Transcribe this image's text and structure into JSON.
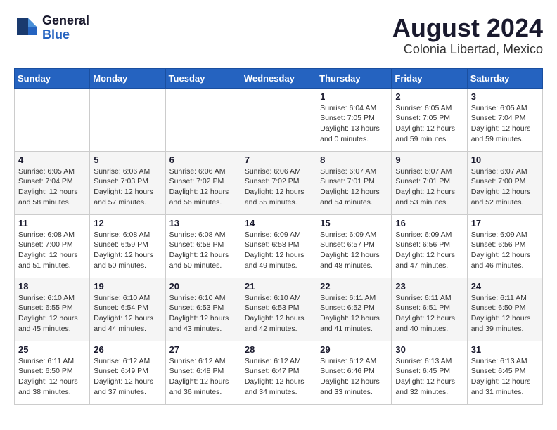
{
  "header": {
    "logo_general": "General",
    "logo_blue": "Blue",
    "title": "August 2024",
    "subtitle": "Colonia Libertad, Mexico"
  },
  "weekdays": [
    "Sunday",
    "Monday",
    "Tuesday",
    "Wednesday",
    "Thursday",
    "Friday",
    "Saturday"
  ],
  "weeks": [
    [
      null,
      null,
      null,
      null,
      {
        "day": "1",
        "sunrise": "6:04 AM",
        "sunset": "7:05 PM",
        "daylight": "13 hours and 0 minutes."
      },
      {
        "day": "2",
        "sunrise": "6:05 AM",
        "sunset": "7:05 PM",
        "daylight": "12 hours and 59 minutes."
      },
      {
        "day": "3",
        "sunrise": "6:05 AM",
        "sunset": "7:04 PM",
        "daylight": "12 hours and 59 minutes."
      }
    ],
    [
      {
        "day": "4",
        "sunrise": "6:05 AM",
        "sunset": "7:04 PM",
        "daylight": "12 hours and 58 minutes."
      },
      {
        "day": "5",
        "sunrise": "6:06 AM",
        "sunset": "7:03 PM",
        "daylight": "12 hours and 57 minutes."
      },
      {
        "day": "6",
        "sunrise": "6:06 AM",
        "sunset": "7:02 PM",
        "daylight": "12 hours and 56 minutes."
      },
      {
        "day": "7",
        "sunrise": "6:06 AM",
        "sunset": "7:02 PM",
        "daylight": "12 hours and 55 minutes."
      },
      {
        "day": "8",
        "sunrise": "6:07 AM",
        "sunset": "7:01 PM",
        "daylight": "12 hours and 54 minutes."
      },
      {
        "day": "9",
        "sunrise": "6:07 AM",
        "sunset": "7:01 PM",
        "daylight": "12 hours and 53 minutes."
      },
      {
        "day": "10",
        "sunrise": "6:07 AM",
        "sunset": "7:00 PM",
        "daylight": "12 hours and 52 minutes."
      }
    ],
    [
      {
        "day": "11",
        "sunrise": "6:08 AM",
        "sunset": "7:00 PM",
        "daylight": "12 hours and 51 minutes."
      },
      {
        "day": "12",
        "sunrise": "6:08 AM",
        "sunset": "6:59 PM",
        "daylight": "12 hours and 50 minutes."
      },
      {
        "day": "13",
        "sunrise": "6:08 AM",
        "sunset": "6:58 PM",
        "daylight": "12 hours and 50 minutes."
      },
      {
        "day": "14",
        "sunrise": "6:09 AM",
        "sunset": "6:58 PM",
        "daylight": "12 hours and 49 minutes."
      },
      {
        "day": "15",
        "sunrise": "6:09 AM",
        "sunset": "6:57 PM",
        "daylight": "12 hours and 48 minutes."
      },
      {
        "day": "16",
        "sunrise": "6:09 AM",
        "sunset": "6:56 PM",
        "daylight": "12 hours and 47 minutes."
      },
      {
        "day": "17",
        "sunrise": "6:09 AM",
        "sunset": "6:56 PM",
        "daylight": "12 hours and 46 minutes."
      }
    ],
    [
      {
        "day": "18",
        "sunrise": "6:10 AM",
        "sunset": "6:55 PM",
        "daylight": "12 hours and 45 minutes."
      },
      {
        "day": "19",
        "sunrise": "6:10 AM",
        "sunset": "6:54 PM",
        "daylight": "12 hours and 44 minutes."
      },
      {
        "day": "20",
        "sunrise": "6:10 AM",
        "sunset": "6:53 PM",
        "daylight": "12 hours and 43 minutes."
      },
      {
        "day": "21",
        "sunrise": "6:10 AM",
        "sunset": "6:53 PM",
        "daylight": "12 hours and 42 minutes."
      },
      {
        "day": "22",
        "sunrise": "6:11 AM",
        "sunset": "6:52 PM",
        "daylight": "12 hours and 41 minutes."
      },
      {
        "day": "23",
        "sunrise": "6:11 AM",
        "sunset": "6:51 PM",
        "daylight": "12 hours and 40 minutes."
      },
      {
        "day": "24",
        "sunrise": "6:11 AM",
        "sunset": "6:50 PM",
        "daylight": "12 hours and 39 minutes."
      }
    ],
    [
      {
        "day": "25",
        "sunrise": "6:11 AM",
        "sunset": "6:50 PM",
        "daylight": "12 hours and 38 minutes."
      },
      {
        "day": "26",
        "sunrise": "6:12 AM",
        "sunset": "6:49 PM",
        "daylight": "12 hours and 37 minutes."
      },
      {
        "day": "27",
        "sunrise": "6:12 AM",
        "sunset": "6:48 PM",
        "daylight": "12 hours and 36 minutes."
      },
      {
        "day": "28",
        "sunrise": "6:12 AM",
        "sunset": "6:47 PM",
        "daylight": "12 hours and 34 minutes."
      },
      {
        "day": "29",
        "sunrise": "6:12 AM",
        "sunset": "6:46 PM",
        "daylight": "12 hours and 33 minutes."
      },
      {
        "day": "30",
        "sunrise": "6:13 AM",
        "sunset": "6:45 PM",
        "daylight": "12 hours and 32 minutes."
      },
      {
        "day": "31",
        "sunrise": "6:13 AM",
        "sunset": "6:45 PM",
        "daylight": "12 hours and 31 minutes."
      }
    ]
  ],
  "labels": {
    "sunrise": "Sunrise:",
    "sunset": "Sunset:",
    "daylight": "Daylight:"
  }
}
